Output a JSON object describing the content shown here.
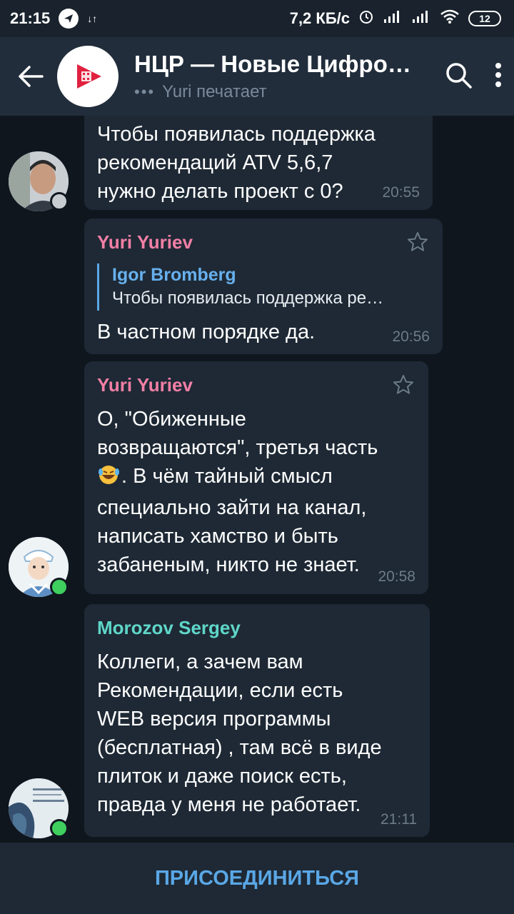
{
  "status_bar": {
    "time": "21:15",
    "network_arrows": "↓↑",
    "speed": "7,2 КБ/с",
    "battery": "12"
  },
  "header": {
    "title": "НЦР — Новые Цифро…",
    "typing_dots": "•••",
    "subtitle": "Yuri печатает"
  },
  "messages": [
    {
      "lines": [
        "Чтобы появилась поддержка",
        "рекомендаций ATV 5,6,7",
        "нужно делать проект с 0?"
      ],
      "time": "20:55"
    },
    {
      "sender": "Yuri Yuriev",
      "sender_color": "#f27fa5",
      "reply": {
        "name": "Igor Bromberg",
        "text": "Чтобы появилась поддержка ре…"
      },
      "lines": [
        "В частном порядке да."
      ],
      "time": "20:56"
    },
    {
      "sender": "Yuri Yuriev",
      "sender_color": "#f27fa5",
      "lines": [
        "О, \"Обиженные",
        "возвращаются\", третья часть",
        ". В чём тайный смысл",
        "специально зайти на канал,",
        "написать хамство и быть",
        "забаненым, никто не знает."
      ],
      "time": "20:58"
    },
    {
      "sender": "Morozov Sergey",
      "sender_color": "#5fd6c8",
      "lines": [
        "Коллеги, а зачем вам",
        "Рекомендации, если есть",
        "WEB версия программы",
        "(бесплатная) , там всё в виде",
        "плиток и даже поиск есть,",
        "правда у меня не работает."
      ],
      "time": "21:11"
    }
  ],
  "join_label": "ПРИСОЕДИНИТЬСЯ",
  "colors": {
    "background": "#0f161e",
    "header": "#212d3b",
    "bubble": "#1e2935",
    "accent": "#5aa7e6",
    "online": "#3ecf5e"
  },
  "icons": [
    "back-arrow-icon",
    "search-icon",
    "more-vert-icon",
    "star-icon",
    "laughing-emoji-icon",
    "play-logo-icon",
    "wifi-icon",
    "signal-icon",
    "alarm-icon"
  ]
}
